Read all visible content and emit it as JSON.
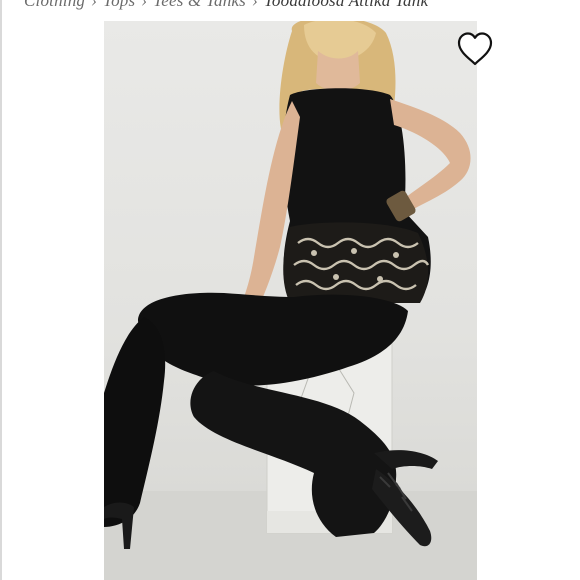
{
  "breadcrumb": {
    "items": [
      "Clothing",
      "Tops",
      "Tees & Tanks"
    ],
    "separator": "›",
    "current": "Toodaloosa Attika Tank"
  },
  "product_image": {
    "alt": "Model wearing black embellished tank with black flare jeans and lace-up heels, seated on a white block"
  },
  "icons": {
    "favorite": "heart-outline-icon"
  },
  "colors": {
    "background": "#ffffff",
    "photo_backdrop": "#e4e4e1",
    "garment_black": "#111111",
    "embroidery": "#c9c2b0"
  }
}
